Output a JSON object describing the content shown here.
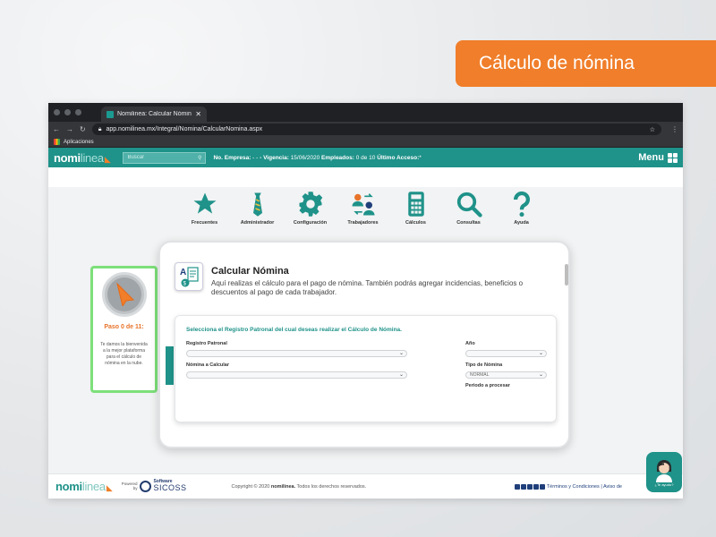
{
  "banner": {
    "title": "Cálculo de nómina"
  },
  "browser": {
    "tab_title": "Nomilinea: Calcular Nómina",
    "url": "app.nomilinea.mx/Integral/Nomina/CalcularNomina.aspx",
    "bookmark": "Aplicaciones"
  },
  "appbar": {
    "logo_a": "nomi",
    "logo_b": "linea",
    "search_placeholder": "Buscar",
    "empresa_label": "No. Empresa:",
    "empresa_value": "- -",
    "vigencia_label": "Vigencia:",
    "vigencia_value": "15/06/2020",
    "empleados_label": "Empleados:",
    "empleados_value": "0 de 10",
    "ultimo_label": "Último Acceso:",
    "ultimo_value": "*",
    "menu": "Menu"
  },
  "nav": [
    {
      "label": "Frecuentes",
      "icon": "star-icon"
    },
    {
      "label": "Administrador",
      "icon": "tie-icon"
    },
    {
      "label": "Configuración",
      "icon": "gear-icon"
    },
    {
      "label": "Trabajadores",
      "icon": "workers-icon"
    },
    {
      "label": "Cálculos",
      "icon": "calculator-icon"
    },
    {
      "label": "Consultas",
      "icon": "magnifier-icon"
    },
    {
      "label": "Ayuda",
      "icon": "question-icon"
    }
  ],
  "step": {
    "title": "Paso 0 de 11:",
    "text": "Te damos la bienvenida a la mejor plataforma para el cálculo de nómina en la nube."
  },
  "card": {
    "title": "Calcular Nómina",
    "desc": "Aquí realizas el cálculo para el pago de nómina. También podrás agregar incidencias, beneficios o descuentos al pago de cada trabajador."
  },
  "form": {
    "heading": "Selecciona el Registro Patronal del cual deseas realizar el Cálculo de Nómina.",
    "registro_label": "Registro Patronal",
    "anio_label": "Año",
    "nomina_label": "Nómina a Calcular",
    "tipo_label": "Tipo de Nómina",
    "tipo_value": "NORMAL",
    "periodo_label": "Periodo a procesar"
  },
  "footer": {
    "powered": "Powered by",
    "software": "Software",
    "sicoss": "SICOSS",
    "copyright_pre": "Copyright © 2020",
    "copyright_brand": "nomilinea.",
    "copyright_post": "Todos los derechos reservados.",
    "terms": "Términos y Condiciones | Aviso de"
  },
  "help": {
    "label": "¿Te ayudo?"
  },
  "colors": {
    "teal": "#1f9289",
    "orange": "#f07e2a",
    "green_border": "#7de07a"
  }
}
